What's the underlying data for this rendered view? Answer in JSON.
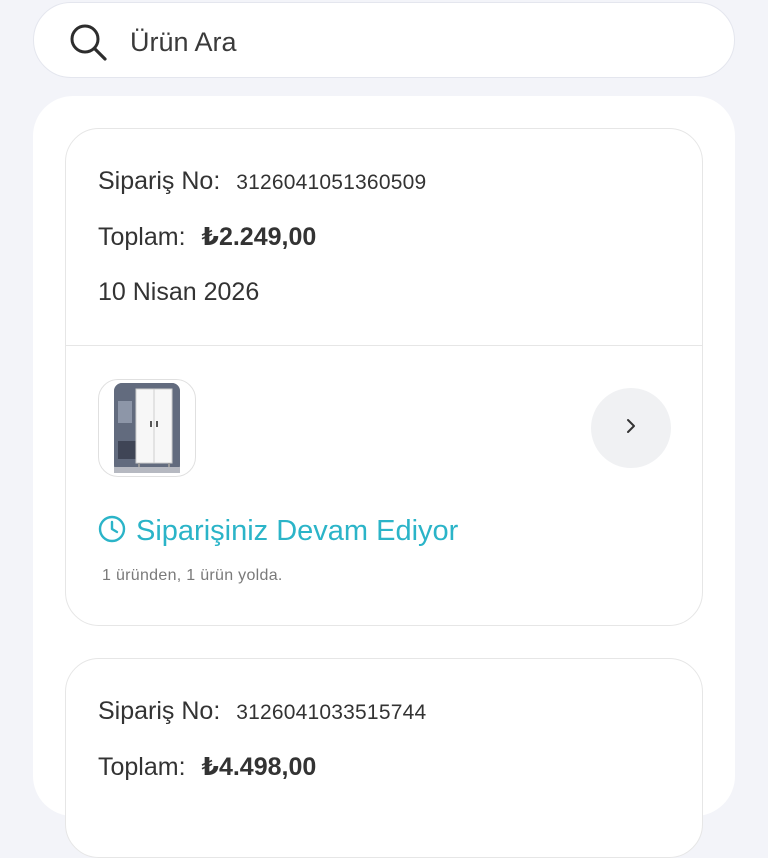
{
  "search": {
    "placeholder": "Ürün Ara",
    "icon": "search-icon"
  },
  "colors": {
    "accent": "#2bb4c8",
    "background": "#f3f4f9",
    "card": "#ffffff",
    "border": "#e6e6e6"
  },
  "orders": [
    {
      "order_no_label": "Sipariş No:",
      "order_no": "3126041051360509",
      "total_label": "Toplam:",
      "total": "₺2.249,00",
      "date": "10 Nisan 2026",
      "product_image": "wardrobe-product-thumbnail",
      "status_icon": "clock-icon",
      "status": "Siparişiniz Devam Ediyor",
      "status_detail": "1 üründen, 1 ürün yolda.",
      "next_icon": "chevron-right-icon"
    },
    {
      "order_no_label": "Sipariş No:",
      "order_no": "3126041033515744",
      "total_label": "Toplam:",
      "total": "₺4.498,00"
    }
  ]
}
